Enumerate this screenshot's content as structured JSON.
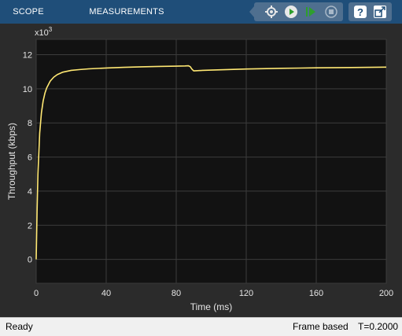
{
  "toolstrip": {
    "tabs": [
      {
        "label": "SCOPE"
      },
      {
        "label": "MEASUREMENTS"
      }
    ],
    "buttons": [
      {
        "icon": "highlight-blocks-icon"
      },
      {
        "icon": "run-icon"
      },
      {
        "icon": "step-forward-icon"
      },
      {
        "icon": "stop-icon"
      },
      {
        "icon": "help-icon"
      },
      {
        "icon": "undock-icon"
      }
    ],
    "run_color": "#2e9e2e",
    "step_color": "#2e9e2e"
  },
  "chart_data": {
    "type": "line",
    "title": "",
    "xlabel": "Time (ms)",
    "ylabel": "Throughput (kbps)",
    "y_exponent_label": "x10",
    "y_exponent_sup": "3",
    "xlim": [
      0,
      200
    ],
    "ylim": [
      -1400,
      12900
    ],
    "xticks": [
      0,
      40,
      80,
      120,
      160,
      200
    ],
    "yticks": [
      0,
      2000,
      4000,
      6000,
      8000,
      10000,
      12000
    ],
    "ytick_labels": [
      "0",
      "2",
      "4",
      "6",
      "8",
      "10",
      "12"
    ],
    "grid": true,
    "background": "#121212",
    "line_color": "#ffe873",
    "series": [
      {
        "values_x": [
          0,
          0.5,
          1,
          2,
          3,
          4,
          5,
          6,
          8,
          10,
          12,
          15,
          20,
          25,
          30,
          40,
          50,
          60,
          70,
          80,
          85,
          87,
          88,
          89,
          90,
          95,
          100,
          120,
          140,
          160,
          180,
          200
        ],
        "values_y": [
          0,
          2800,
          5000,
          7400,
          8600,
          9300,
          9750,
          10050,
          10450,
          10680,
          10830,
          10970,
          11080,
          11130,
          11170,
          11220,
          11260,
          11290,
          11310,
          11330,
          11340,
          11350,
          11300,
          11150,
          11050,
          11080,
          11100,
          11160,
          11200,
          11230,
          11250,
          11270
        ]
      }
    ]
  },
  "status": {
    "left": "Ready",
    "frame": "Frame based",
    "time": "T=0.2000"
  }
}
